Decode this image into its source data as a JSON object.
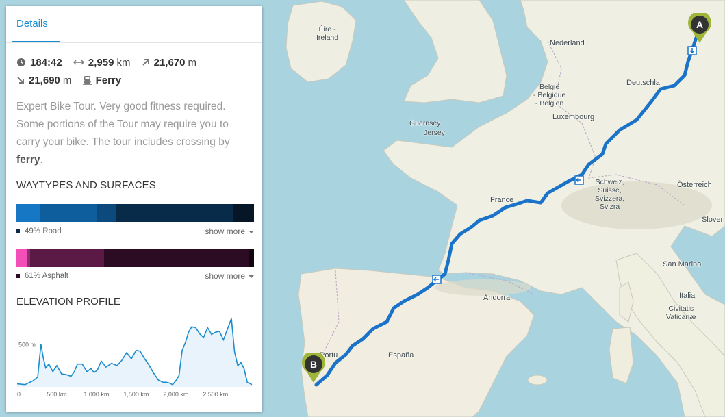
{
  "tabs": {
    "details": "Details"
  },
  "stats": {
    "duration": "184:42",
    "distance": "2,959",
    "distance_unit": "km",
    "uphill": "21,670",
    "uphill_unit": "m",
    "downhill": "21,690",
    "downhill_unit": "m",
    "extra": "Ferry"
  },
  "description": {
    "text": "Expert Bike Tour. Very good fitness required. Some portions of the Tour may require you to carry your bike. The tour includes crossing by ",
    "bold": "ferry",
    "end": "."
  },
  "waytypes": {
    "title": "WAYTYPES AND SURFACES",
    "waytype_segments": [
      {
        "name": "waytype-1",
        "fraction": 0.1,
        "color": "#1677c4"
      },
      {
        "name": "waytype-2",
        "fraction": 0.24,
        "color": "#0e5d9c"
      },
      {
        "name": "waytype-3",
        "fraction": 0.08,
        "color": "#0c4a7e"
      },
      {
        "name": "waytype-4",
        "fraction": 0.49,
        "color": "#082b4a"
      },
      {
        "name": "waytype-5",
        "fraction": 0.09,
        "color": "#061626"
      }
    ],
    "waytype_legend": "49% Road",
    "waytype_legend_color": "#082b4a",
    "surface_segments": [
      {
        "name": "surface-1",
        "fraction": 0.05,
        "color": "#f24fb9"
      },
      {
        "name": "surface-2",
        "fraction": 0.01,
        "color": "#8b2f6e"
      },
      {
        "name": "surface-3",
        "fraction": 0.31,
        "color": "#5b1a45"
      },
      {
        "name": "surface-4",
        "fraction": 0.61,
        "color": "#2c0c22"
      },
      {
        "name": "surface-5",
        "fraction": 0.02,
        "color": "#12050e"
      }
    ],
    "surface_legend": "61% Asphalt",
    "surface_legend_color": "#2c0c22",
    "show_more": "show more"
  },
  "elevation": {
    "title": "ELEVATION PROFILE",
    "y_tick_label": "500 m",
    "x_ticks": [
      "0",
      "500 km",
      "1,000 km",
      "1,500 km",
      "2,000 km",
      "2,500 km"
    ]
  },
  "chart_data": {
    "type": "area",
    "x_unit": "km",
    "y_unit": "m",
    "xlim": [
      0,
      2959
    ],
    "ylim": [
      0,
      1000
    ],
    "y_ticks": [
      500
    ],
    "x_ticks": [
      0,
      500,
      1000,
      1500,
      2000,
      2500
    ],
    "x": [
      0,
      100,
      200,
      260,
      300,
      330,
      360,
      400,
      450,
      500,
      560,
      620,
      680,
      720,
      760,
      820,
      880,
      930,
      970,
      1010,
      1060,
      1120,
      1190,
      1260,
      1320,
      1380,
      1440,
      1500,
      1550,
      1600,
      1660,
      1720,
      1780,
      1840,
      1880,
      1920,
      1960,
      2000,
      2040,
      2080,
      2120,
      2160,
      2200,
      2250,
      2300,
      2350,
      2400,
      2450,
      2500,
      2550,
      2600,
      2650,
      2700,
      2740,
      2780,
      2820,
      2860,
      2900,
      2959
    ],
    "y": [
      40,
      30,
      80,
      130,
      560,
      380,
      250,
      300,
      200,
      280,
      170,
      160,
      140,
      200,
      300,
      300,
      200,
      240,
      190,
      220,
      340,
      260,
      310,
      280,
      350,
      450,
      370,
      480,
      470,
      380,
      290,
      180,
      90,
      60,
      60,
      50,
      30,
      80,
      150,
      480,
      580,
      720,
      790,
      780,
      700,
      650,
      780,
      690,
      720,
      730,
      620,
      760,
      900,
      460,
      280,
      320,
      240,
      60,
      30
    ],
    "fill_color": "#e9f3fb",
    "line_color": "#1a8dcf"
  },
  "map": {
    "labels": {
      "ireland": "Éire -\nIreland",
      "nederland": "Nederland",
      "belgie": "België\n- Belgique\n- Belgien",
      "deutschland": "Deutschla",
      "luxembourg": "Luxembourg",
      "guernsey": "Guernsey",
      "jersey": "Jersey",
      "france": "France",
      "schweiz": "Schweiz,\nSuisse,\nSvizzera,\nSvizra",
      "osterreich": "Österreich",
      "slovenija": "Sloven",
      "san_marino": "San Marino",
      "italia": "Italia",
      "vatican": "Civitatis\nVaticanæ",
      "andorra": "Andorra",
      "espana": "España",
      "portugal": "Portu"
    },
    "marker_start": "A",
    "marker_end": "B",
    "route_color": "#1a73c8",
    "marker_color": "#9fb53a"
  }
}
